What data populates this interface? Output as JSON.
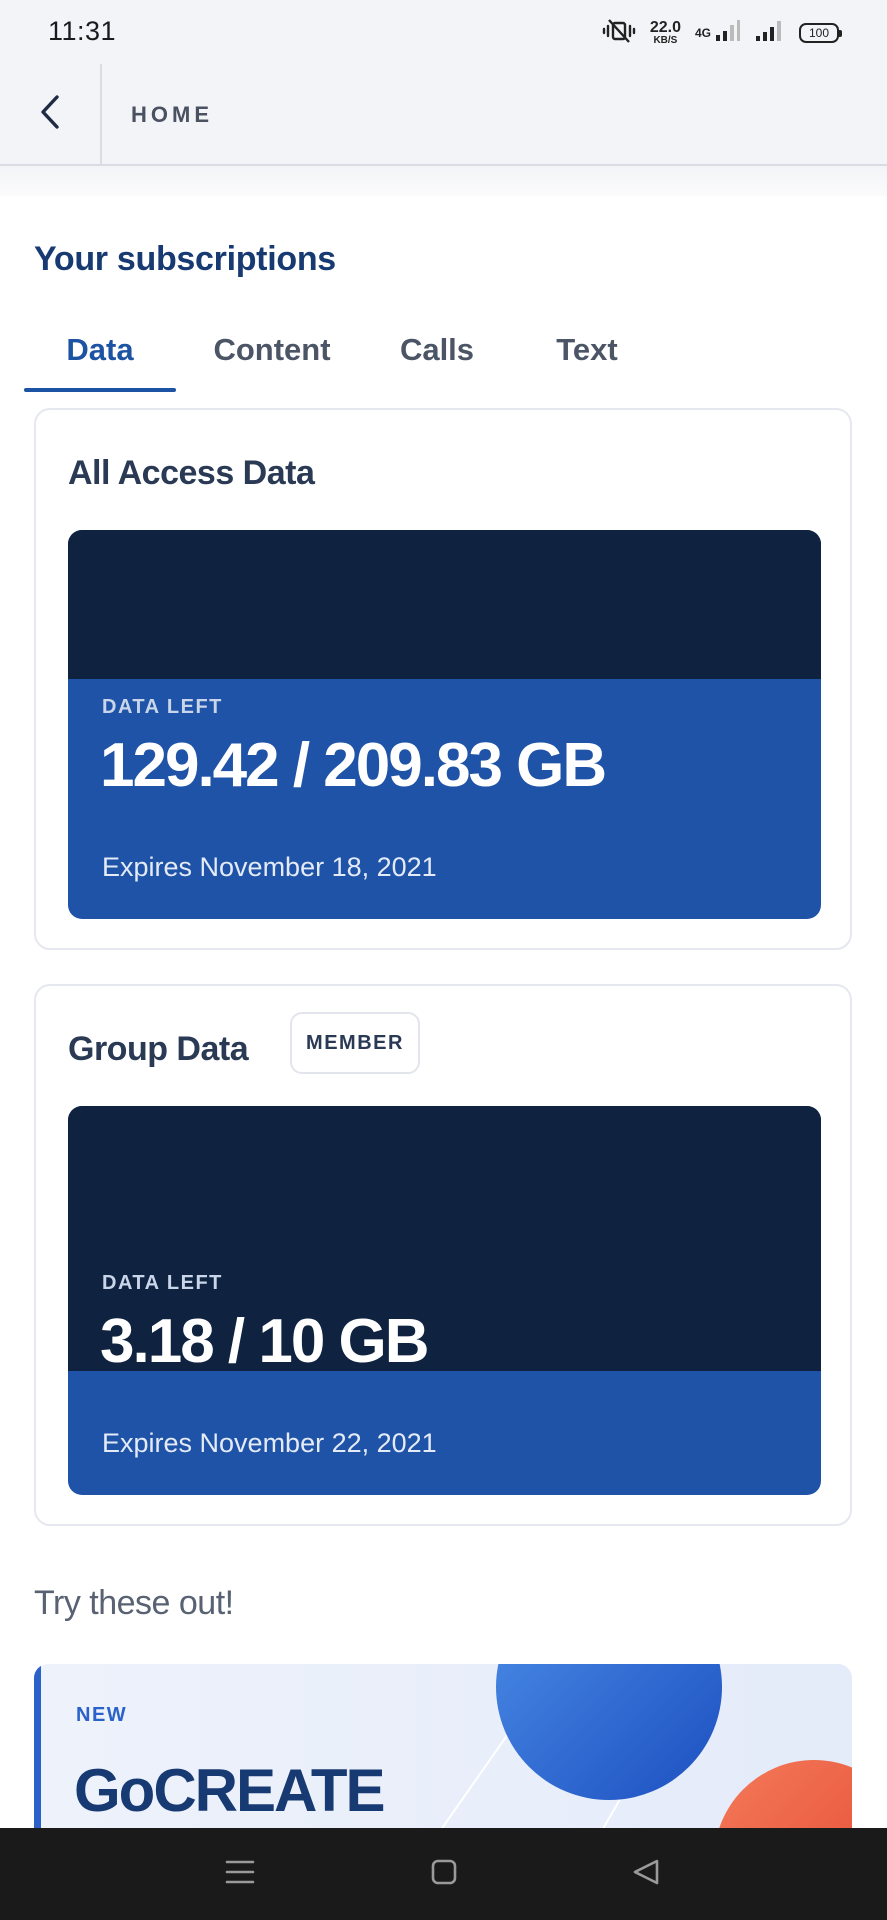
{
  "status_bar": {
    "time": "11:31",
    "net_speed_value": "22.0",
    "net_speed_unit": "KB/S",
    "network_type": "4G",
    "battery": "100"
  },
  "header": {
    "title": "HOME"
  },
  "subscriptions": {
    "title": "Your subscriptions",
    "tabs": [
      {
        "label": "Data",
        "active": true
      },
      {
        "label": "Content",
        "active": false
      },
      {
        "label": "Calls",
        "active": false
      },
      {
        "label": "Text",
        "active": false
      }
    ]
  },
  "cards": [
    {
      "title": "All Access Data",
      "data_left_label": "DATA LEFT",
      "amount": "129.42 / 209.83 GB",
      "remaining_fraction": 0.617,
      "expiry": "Expires November 18, 2021"
    },
    {
      "title": "Group Data",
      "badge": "MEMBER",
      "data_left_label": "DATA LEFT",
      "amount": "3.18 / 10 GB",
      "remaining_fraction": 0.318,
      "expiry": "Expires November 22, 2021"
    }
  ],
  "try_section": {
    "title": "Try these out!",
    "promo_tag": "NEW",
    "promo_title": "GoCREATE"
  },
  "colors": {
    "accent": "#1d53a3",
    "data_remaining": "#1f53a7",
    "data_used": "#0f2240",
    "promo_orange": "#e2442f"
  },
  "icons": {
    "back": "chevron-left-icon",
    "nav_menu": "menu-icon",
    "nav_home": "home-square-icon",
    "nav_back": "triangle-back-icon"
  }
}
